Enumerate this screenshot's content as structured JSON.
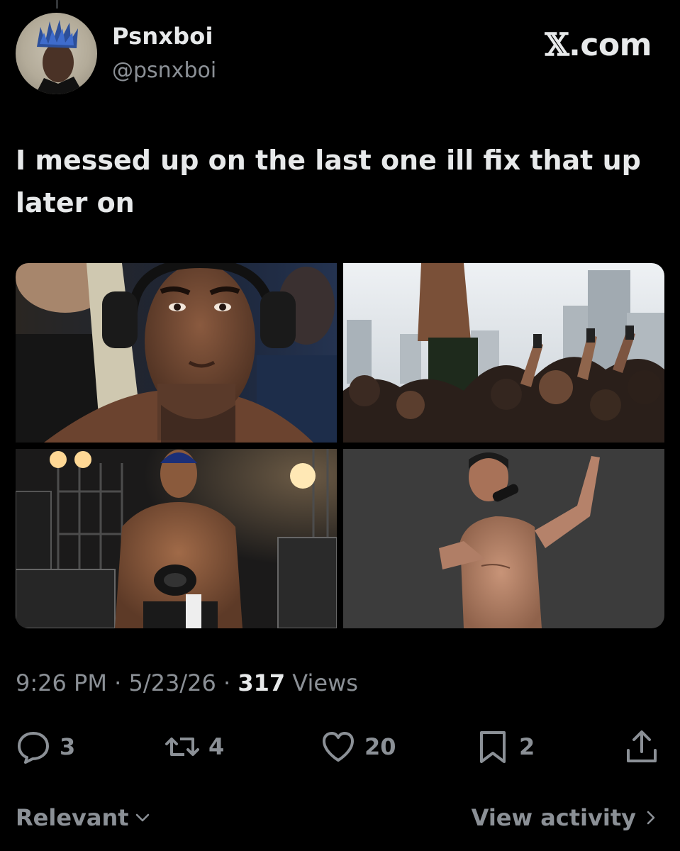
{
  "author": {
    "display_name": "Psnxboi",
    "handle": "@psnxboi"
  },
  "brand": {
    "x_glyph": "𝕏",
    "suffix": ".com"
  },
  "tweet": {
    "text": "I messed up on the last one ill fix that up later on"
  },
  "media": [
    {
      "name": "headphones-portrait"
    },
    {
      "name": "crowd-performance"
    },
    {
      "name": "backstage-figure"
    },
    {
      "name": "microphone-pose"
    }
  ],
  "meta": {
    "time": "9:26 PM",
    "sep1": " · ",
    "date": "5/23/26",
    "sep2": " · ",
    "views_count": "317",
    "views_label": " Views"
  },
  "actions": {
    "reply_count": "3",
    "repost_count": "4",
    "like_count": "20",
    "bookmark_count": "2"
  },
  "footer": {
    "sort_label": "Relevant",
    "activity_label": "View activity"
  },
  "colors": {
    "background": "#000000",
    "text_primary": "#e7e9ea",
    "text_secondary": "#8b9096"
  },
  "icons": [
    "reply-icon",
    "repost-icon",
    "like-icon",
    "bookmark-icon",
    "share-icon",
    "chevron-down-icon",
    "chevron-right-icon"
  ]
}
